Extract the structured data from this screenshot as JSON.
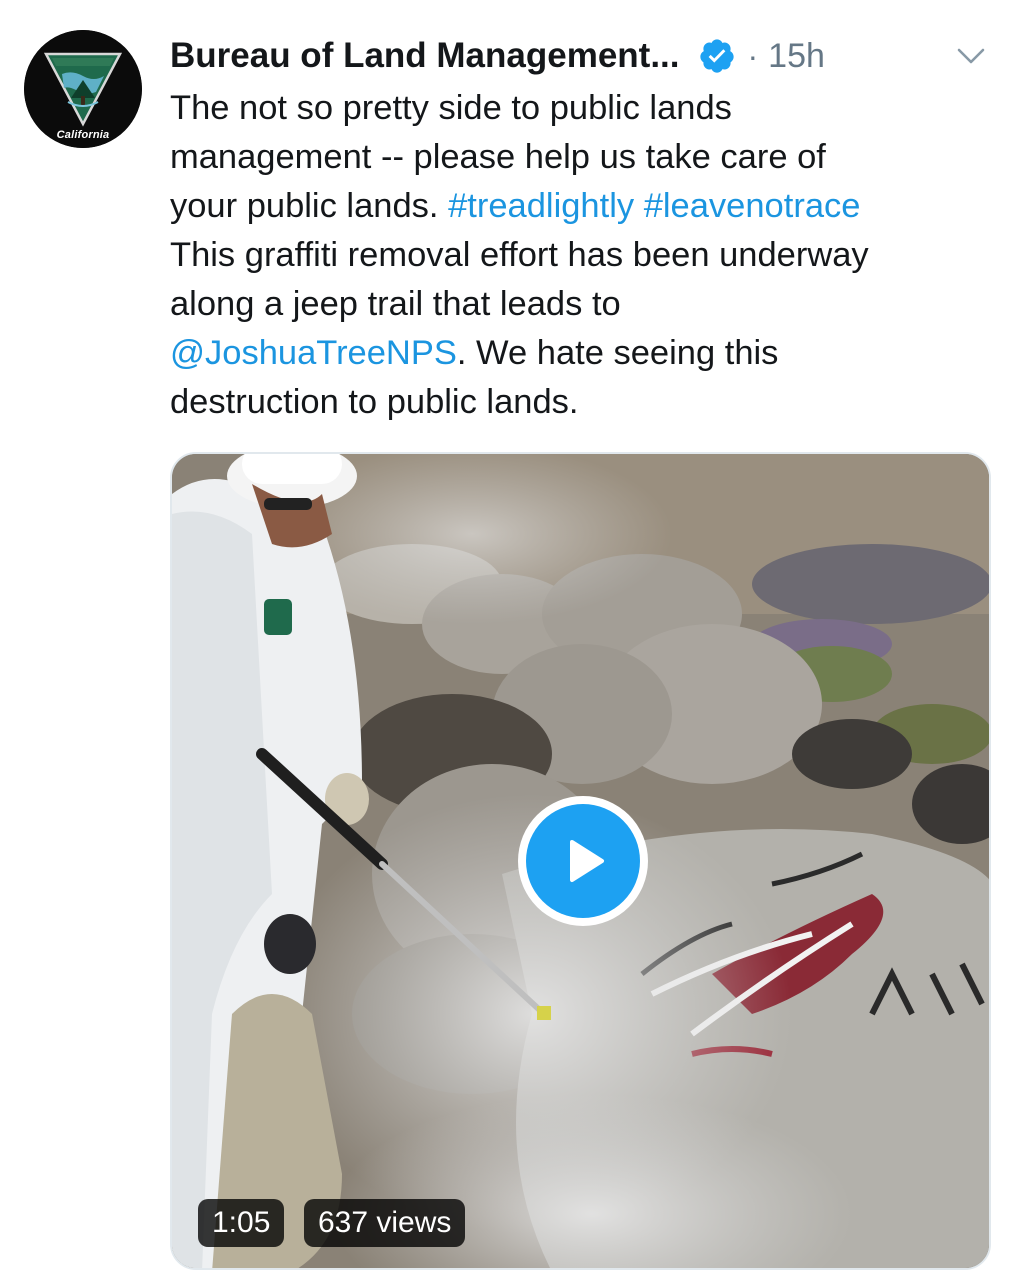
{
  "author": {
    "name": "Bureau of Land Management...",
    "avatar_label": "California",
    "verified_icon": "verified-badge-icon"
  },
  "meta": {
    "separator": "·",
    "timestamp": "15h"
  },
  "tweet": {
    "l1": "The not so pretty side to public lands",
    "l2": "management -- please help us take care of",
    "l3_text": "your public lands. ",
    "hashtag1": "#treadlightly",
    "hashtag2": "#leavenotrace",
    "l4": "This graffiti removal effort has been underway",
    "l5": "along a jeep trail that leads to",
    "mention": "@JoshuaTreeNPS",
    "l6_rest": ". We hate seeing this",
    "l7": "destruction to public lands."
  },
  "media": {
    "duration": "1:05",
    "views": "637 views",
    "play_icon": "play-icon"
  },
  "colors": {
    "link": "#1b95e0",
    "play": "#1da1f2",
    "muted": "#657786",
    "text": "#14171a"
  }
}
